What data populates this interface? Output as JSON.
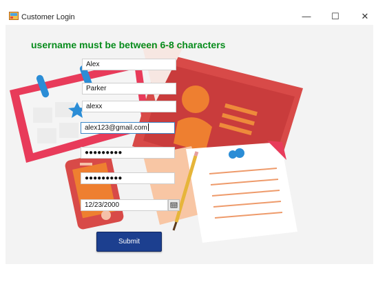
{
  "window": {
    "title": "Customer Login",
    "minimize": "—",
    "maximize": "☐",
    "close": "✕"
  },
  "validation_message": "username must be between 6-8 characters",
  "form": {
    "first_name": "Alex",
    "last_name": "Parker",
    "username": "alexx",
    "email": "alex123@gmail.com",
    "password": "●●●●●●●●●",
    "confirm_password": "●●●●●●●●●",
    "birth_date": "12/23/2000",
    "submit_label": "Submit"
  },
  "colors": {
    "validation": "#078c1c",
    "submit_bg": "#1c3f8f",
    "illustration_red": "#d84a48"
  },
  "icons": [
    "app-icon",
    "calendar-icon",
    "folder-illustration",
    "phone-illustration",
    "document-illustration",
    "pencil-illustration"
  ]
}
